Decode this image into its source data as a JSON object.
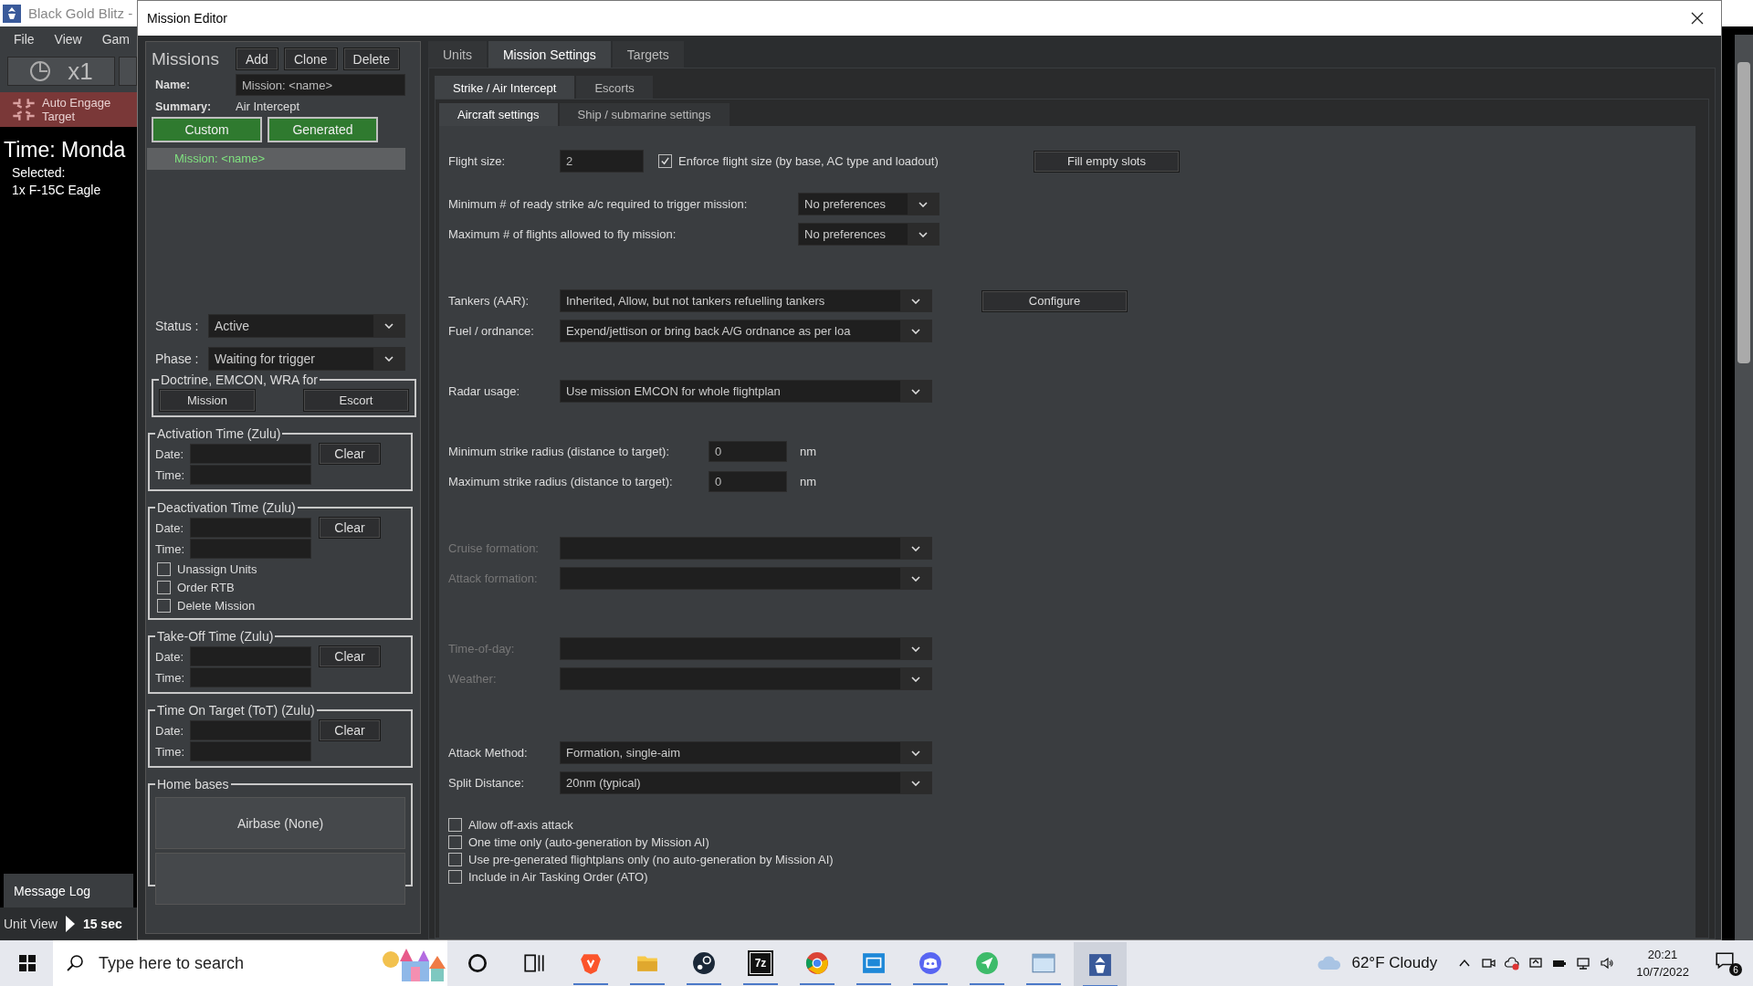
{
  "background_app": {
    "title": "Black Gold Blitz -",
    "menu": [
      "File",
      "View",
      "Gam"
    ],
    "speed": "x1",
    "auto_engage": "Auto Engage Target",
    "time": "Time: Monda",
    "selected_label": "Selected:",
    "selected_unit": "1x F-15C Eagle",
    "message_log": "Message Log",
    "view": "Unit View",
    "step": "15 sec"
  },
  "window": {
    "title": "Mission Editor"
  },
  "missions": {
    "heading": "Missions",
    "buttons": [
      "Add",
      "Clone",
      "Delete"
    ],
    "name_label": "Name:",
    "name": "Mission: <name>",
    "summary_label": "Summary:",
    "summary": "Air Intercept",
    "filters": [
      {
        "label": "Custom",
        "selected": true
      },
      {
        "label": "Generated",
        "selected": true
      }
    ],
    "list": [
      {
        "label": "Mission: <name>",
        "selected": true
      }
    ],
    "status_label": "Status :",
    "status": "Active",
    "phase_label": "Phase :",
    "phase": "Waiting for trigger",
    "doctrine": {
      "legend": "Doctrine, EMCON, WRA for",
      "buttons": [
        "Mission",
        "Escort"
      ]
    },
    "times": [
      {
        "legend": "Activation Time (Zulu)",
        "date_label": "Date:",
        "time_label": "Time:",
        "clear": "Clear"
      },
      {
        "legend": "Deactivation Time (Zulu)",
        "date_label": "Date:",
        "time_label": "Time:",
        "clear": "Clear",
        "options": [
          {
            "label": "Unassign Units",
            "checked": false
          },
          {
            "label": "Order RTB",
            "checked": false
          },
          {
            "label": "Delete Mission",
            "checked": false
          }
        ]
      },
      {
        "legend": "Take-Off Time (Zulu)",
        "date_label": "Date:",
        "time_label": "Time:",
        "clear": "Clear"
      },
      {
        "legend": "Time On Target (ToT) (Zulu)",
        "date_label": "Date:",
        "time_label": "Time:",
        "clear": "Clear"
      }
    ],
    "home_bases": {
      "legend": "Home bases",
      "buttons": [
        "Airbase (None)"
      ]
    }
  },
  "tabs": [
    {
      "label": "Units",
      "selected": false
    },
    {
      "label": "Mission Settings",
      "selected": true
    },
    {
      "label": "Targets",
      "selected": false
    }
  ],
  "subtabs": [
    {
      "label": "Strike / Air Intercept",
      "selected": true
    },
    {
      "label": "Escorts",
      "selected": false
    }
  ],
  "section_tabs": [
    {
      "label": "Aircraft settings",
      "selected": true
    },
    {
      "label": "Ship / submarine settings",
      "selected": false
    }
  ],
  "settings": {
    "groups": [
      {
        "rows": [
          {
            "kind": "flight-size",
            "label": "Flight size:",
            "value": "2",
            "check_label": "Enforce flight size (by base, AC type and loadout)",
            "checked": true,
            "button": "Fill empty slots"
          }
        ]
      },
      {
        "rows": [
          {
            "kind": "short-dropdown",
            "label": "Minimum # of ready strike a/c required to trigger mission:",
            "value": "No preferences",
            "disabled": false
          },
          {
            "kind": "short-dropdown",
            "label": "Maximum # of flights allowed to fly mission:",
            "value": "No preferences",
            "disabled": false
          }
        ]
      },
      {
        "rows": [
          {
            "kind": "dropdown",
            "label": "Tankers (AAR):",
            "value": "Inherited, Allow, but not tankers refuelling tankers",
            "button": "Configure",
            "disabled": false
          },
          {
            "kind": "dropdown",
            "label": "Fuel / ordnance:",
            "value": "Expend/jettison or bring back A/G ordnance as per loa",
            "disabled": false
          }
        ]
      },
      {
        "rows": [
          {
            "kind": "dropdown",
            "label": "Radar usage:",
            "value": "Use mission EMCON for whole flightplan",
            "disabled": false
          }
        ]
      },
      {
        "rows": [
          {
            "kind": "distance",
            "label": "Minimum strike radius (distance to target):",
            "value": "0",
            "unit": "nm"
          },
          {
            "kind": "distance",
            "label": "Maximum strike radius (distance to target):",
            "value": "0",
            "unit": "nm"
          }
        ]
      },
      {
        "rows": [
          {
            "kind": "dropdown",
            "label": "Cruise formation:",
            "disabled": true
          },
          {
            "kind": "dropdown",
            "label": "Attack formation:",
            "disabled": true
          }
        ]
      },
      {
        "rows": [
          {
            "kind": "dropdown",
            "label": "Time-of-day:",
            "disabled": true
          },
          {
            "kind": "dropdown",
            "label": "Weather:",
            "disabled": true
          }
        ]
      },
      {
        "rows": [
          {
            "kind": "dropdown",
            "label": "Attack Method:",
            "value": "Formation, single-aim",
            "disabled": false
          },
          {
            "kind": "dropdown",
            "label": "Split Distance:",
            "value": "20nm (typical)",
            "disabled": false
          }
        ]
      },
      {
        "rows": [
          {
            "kind": "checkbox",
            "label": "Allow off-axis attack",
            "checked": false
          },
          {
            "kind": "checkbox",
            "label": "One time only (auto-generation by Mission AI)",
            "checked": false
          },
          {
            "kind": "checkbox",
            "label": "Use pre-generated flightplans only (no auto-generation by Mission AI)",
            "checked": false
          },
          {
            "kind": "checkbox",
            "label": "Include in Air Tasking Order (ATO)",
            "checked": false
          }
        ]
      }
    ]
  },
  "taskbar": {
    "search_placeholder": "Type here to search",
    "apps": [
      {
        "kind": "cortana",
        "running": false,
        "selected": false
      },
      {
        "kind": "task-view",
        "running": false,
        "selected": false
      },
      {
        "kind": "brave",
        "running": true,
        "selected": false
      },
      {
        "kind": "files",
        "running": true,
        "selected": false
      },
      {
        "kind": "steam",
        "running": true,
        "selected": false
      },
      {
        "kind": "archiver",
        "label": "7z",
        "running": true,
        "selected": false
      },
      {
        "kind": "chrome",
        "running": true,
        "selected": false
      },
      {
        "kind": "remote",
        "running": true,
        "selected": false
      },
      {
        "kind": "discord",
        "running": true,
        "selected": false
      },
      {
        "kind": "messenger",
        "running": true,
        "selected": false
      },
      {
        "kind": "window",
        "running": true,
        "selected": false
      },
      {
        "kind": "game",
        "running": true,
        "selected": true
      }
    ],
    "weather": "62°F Cloudy",
    "time": "20:21",
    "date": "10/7/2022",
    "notifications": "6"
  }
}
